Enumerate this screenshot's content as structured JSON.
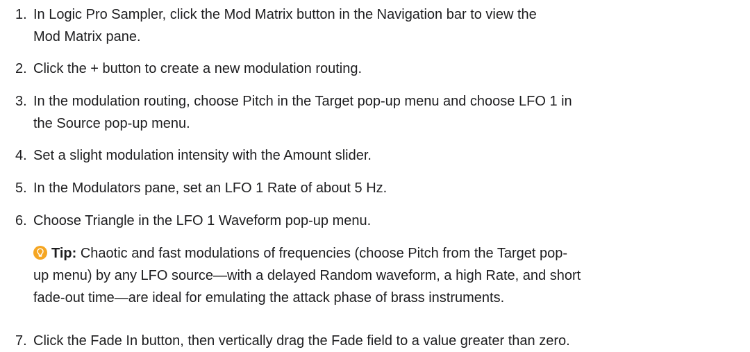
{
  "steps": [
    {
      "num": "1.",
      "text": "In Logic Pro Sampler, click the Mod Matrix button in the Navigation bar to view the\nMod Matrix pane."
    },
    {
      "num": "2.",
      "text": "Click the + button to create a new modulation routing."
    },
    {
      "num": "3.",
      "text": "In the modulation routing, choose Pitch in the Target pop-up menu and choose LFO 1 in\nthe Source pop-up menu."
    },
    {
      "num": "4.",
      "text": "Set a slight modulation intensity with the Amount slider."
    },
    {
      "num": "5.",
      "text": "In the Modulators pane, set an LFO 1 Rate of about 5 Hz."
    },
    {
      "num": "6.",
      "text": "Choose Triangle in the LFO 1 Waveform pop-up menu."
    },
    {
      "num": "7.",
      "text": "Click the Fade In button, then vertically drag the Fade field to a value greater than zero."
    }
  ],
  "tip": {
    "label": "Tip:",
    "text": "Chaotic and fast modulations of frequencies (choose Pitch from the Target pop-\nup menu) by any LFO source—with a delayed Random waveform, a high Rate, and short\nfade-out time—are ideal for emulating the attack phase of brass instruments.",
    "icon": "lightbulb-icon",
    "icon_color": "#f5a623"
  }
}
